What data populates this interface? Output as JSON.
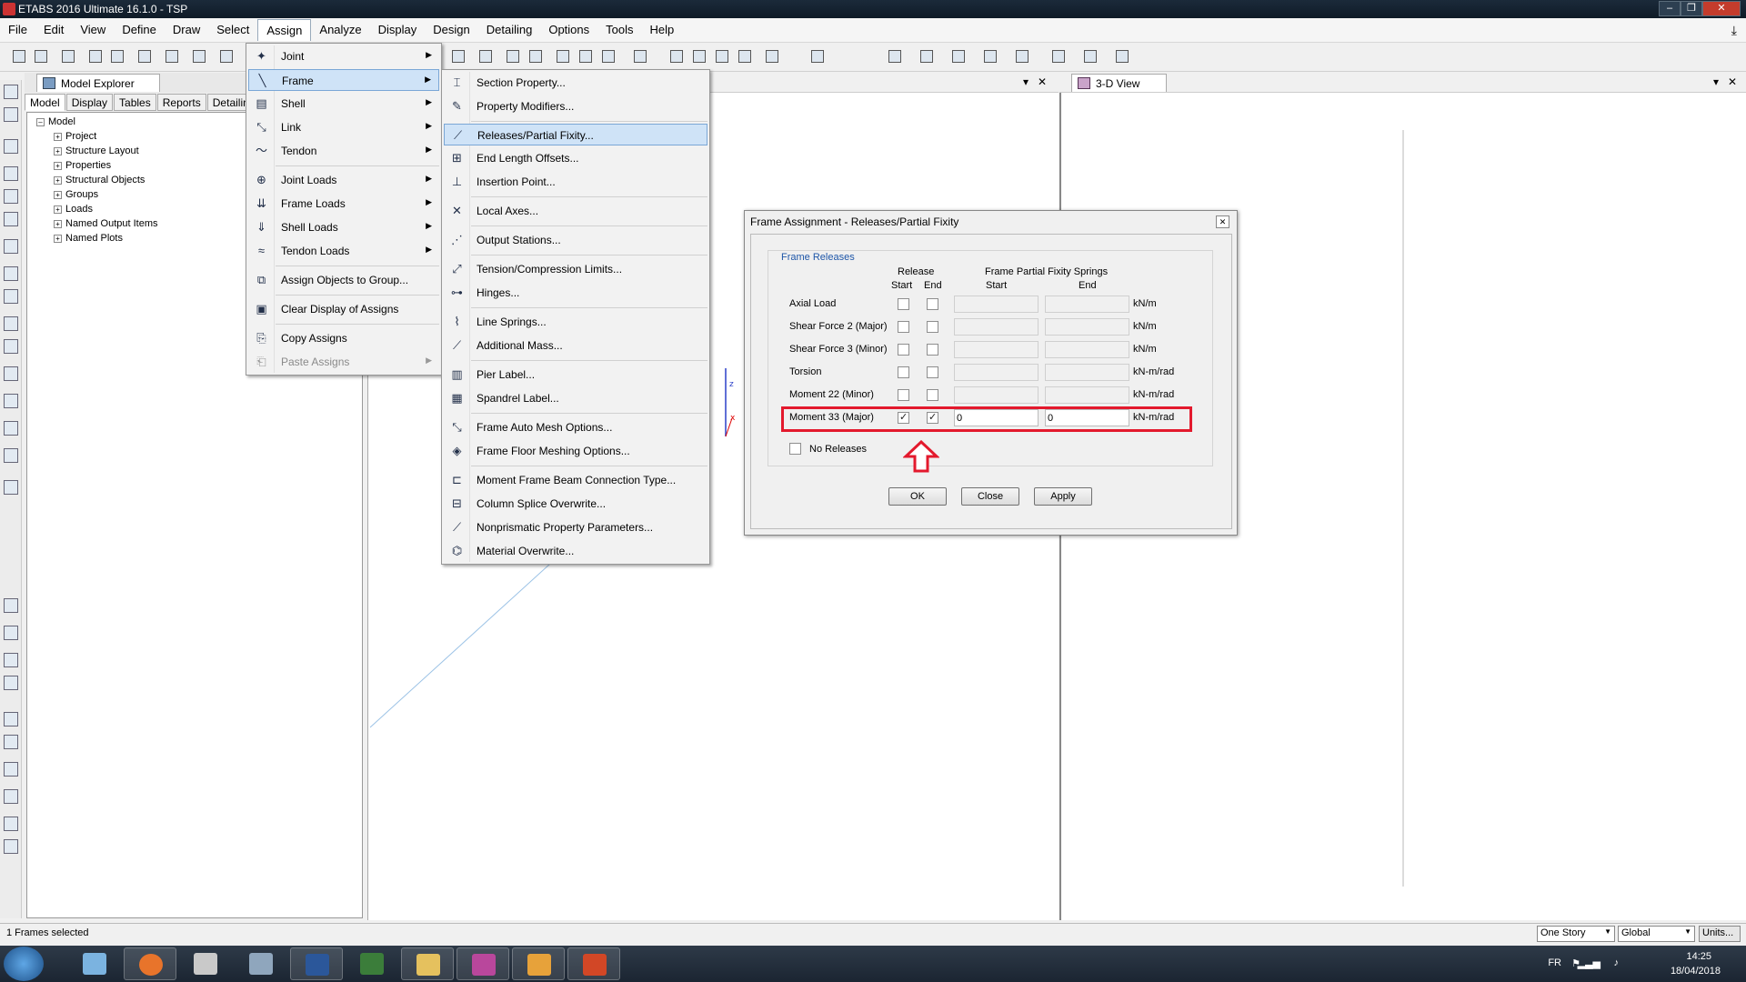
{
  "window": {
    "title": "ETABS 2016 Ultimate 16.1.0 - TSP"
  },
  "menubar": [
    "File",
    "Edit",
    "View",
    "Define",
    "Draw",
    "Select",
    "Assign",
    "Analyze",
    "Display",
    "Design",
    "Detailing",
    "Options",
    "Tools",
    "Help"
  ],
  "explorer": {
    "title": "Model Explorer",
    "tabs": [
      "Model",
      "Display",
      "Tables",
      "Reports",
      "Detailing"
    ],
    "root": "Model",
    "children": [
      "Project",
      "Structure Layout",
      "Properties",
      "Structural Objects",
      "Groups",
      "Loads",
      "Named Output Items",
      "Named Plots"
    ]
  },
  "view3d": {
    "title": "3-D View"
  },
  "assign_menu": {
    "items": [
      {
        "label": "Joint",
        "icon": "joint-icon",
        "submenu": true
      },
      {
        "label": "Frame",
        "icon": "frame-icon",
        "submenu": true
      },
      {
        "label": "Shell",
        "icon": "shell-icon",
        "submenu": true
      },
      {
        "label": "Link",
        "icon": "link-icon",
        "submenu": true
      },
      {
        "label": "Tendon",
        "icon": "tendon-icon",
        "submenu": true
      },
      {
        "label": "Joint Loads",
        "icon": "joint-loads-icon",
        "submenu": true
      },
      {
        "label": "Frame Loads",
        "icon": "frame-loads-icon",
        "submenu": true
      },
      {
        "label": "Shell Loads",
        "icon": "shell-loads-icon",
        "submenu": true
      },
      {
        "label": "Tendon Loads",
        "icon": "tendon-loads-icon",
        "submenu": true
      },
      {
        "label": "Assign Objects to Group...",
        "icon": "group-icon",
        "submenu": false
      },
      {
        "label": "Clear Display of Assigns",
        "icon": "clear-display-icon",
        "submenu": false
      },
      {
        "label": "Copy Assigns",
        "icon": "copy-icon",
        "submenu": false
      },
      {
        "label": "Paste Assigns",
        "icon": "paste-icon",
        "submenu": true,
        "disabled": true
      }
    ]
  },
  "frame_submenu": {
    "items": [
      "Section Property...",
      "Property Modifiers...",
      "Releases/Partial Fixity...",
      "End Length Offsets...",
      "Insertion Point...",
      "Local Axes...",
      "Output Stations...",
      "Tension/Compression Limits...",
      "Hinges...",
      "Line Springs...",
      "Additional Mass...",
      "Pier Label...",
      "Spandrel Label...",
      "Frame Auto Mesh Options...",
      "Frame Floor Meshing Options...",
      "Moment Frame Beam Connection Type...",
      "Column Splice Overwrite...",
      "Nonprismatic Property Parameters...",
      "Material Overwrite..."
    ]
  },
  "dialog": {
    "title": "Frame Assignment - Releases/Partial Fixity",
    "group_title": "Frame Releases",
    "col_release": "Release",
    "col_start": "Start",
    "col_end": "End",
    "col_springs": "Frame Partial Fixity Springs",
    "col_springs_start": "Start",
    "col_springs_end": "End",
    "rows": [
      {
        "label": "Axial Load",
        "start": false,
        "end": false,
        "spring_start": "",
        "spring_end": "",
        "unit": "kN/m"
      },
      {
        "label": "Shear Force 2 (Major)",
        "start": false,
        "end": false,
        "spring_start": "",
        "spring_end": "",
        "unit": "kN/m"
      },
      {
        "label": "Shear Force 3 (Minor)",
        "start": false,
        "end": false,
        "spring_start": "",
        "spring_end": "",
        "unit": "kN/m"
      },
      {
        "label": "Torsion",
        "start": false,
        "end": false,
        "spring_start": "",
        "spring_end": "",
        "unit": "kN-m/rad"
      },
      {
        "label": "Moment 22 (Minor)",
        "start": false,
        "end": false,
        "spring_start": "",
        "spring_end": "",
        "unit": "kN-m/rad"
      },
      {
        "label": "Moment 33 (Major)",
        "start": true,
        "end": true,
        "spring_start": "0",
        "spring_end": "0",
        "unit": "kN-m/rad"
      }
    ],
    "no_releases": "No Releases",
    "buttons": {
      "ok": "OK",
      "close": "Close",
      "apply": "Apply"
    },
    "highlight_color": "#e3192d"
  },
  "statusbar": {
    "text": "1 Frames selected",
    "story": "One Story",
    "coord": "Global",
    "units": "Units..."
  },
  "taskbar": {
    "lang": "FR",
    "time": "14:25",
    "date": "18/04/2018"
  }
}
